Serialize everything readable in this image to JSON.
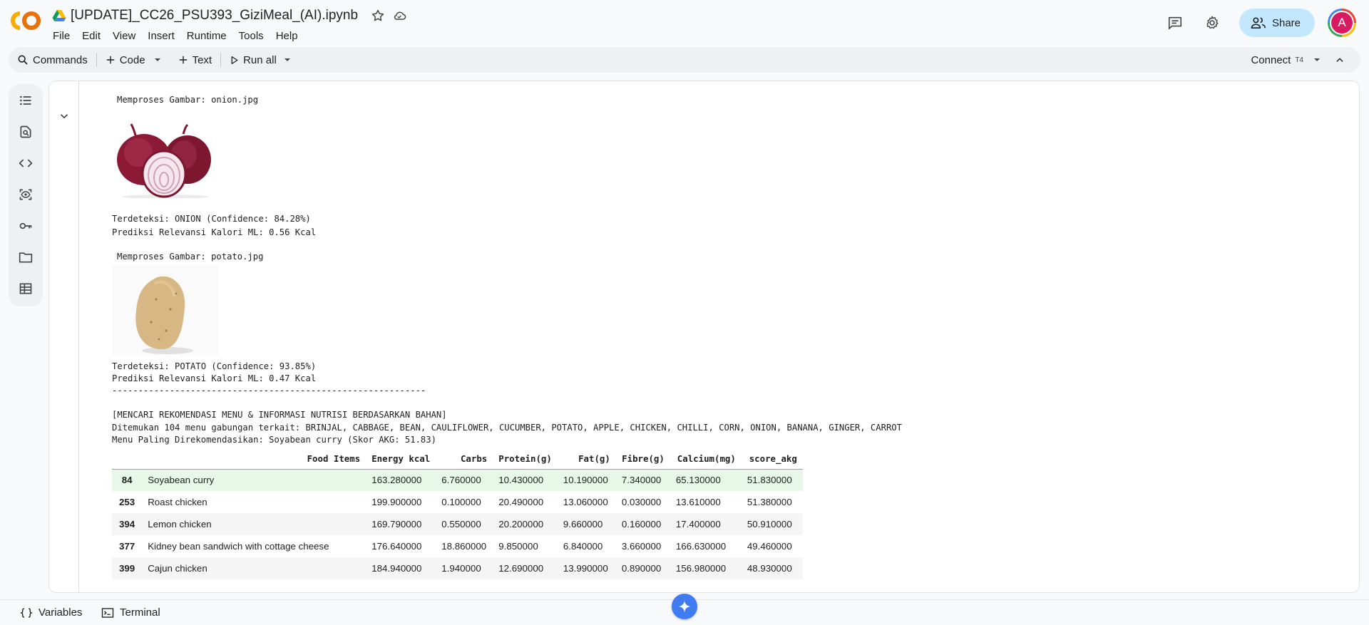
{
  "app": {
    "title": "[UPDATE]_CC26_PSU393_GiziMeal_(AI).ipynb",
    "menu": [
      "File",
      "Edit",
      "View",
      "Insert",
      "Runtime",
      "Tools",
      "Help"
    ],
    "share_label": "Share",
    "avatar_letter": "A"
  },
  "toolbar": {
    "commands": "Commands",
    "code": "Code",
    "text": "Text",
    "run_all": "Run all",
    "connect": "Connect",
    "runtime_badge": "T4"
  },
  "sidebar_icons": [
    "table-of-contents-icon",
    "find-replace-icon",
    "code-snippets-icon",
    "variable-inspector-icon",
    "secrets-key-icon",
    "files-folder-icon",
    "data-table-icon"
  ],
  "output": {
    "onion_header": "Memproses Gambar: onion.jpg",
    "onion_detect": "Terdeteksi: ONION (Confidence: 84.28%)",
    "onion_pred": "Prediksi Relevansi Kalori ML: 0.56 Kcal",
    "potato_header": "Memproses Gambar: potato.jpg",
    "potato_detect": "Terdeteksi: POTATO (Confidence: 93.85%)",
    "potato_pred": "Prediksi Relevansi Kalori ML: 0.47 Kcal",
    "separator": "------------------------------------------------------------",
    "rec_header": "[MENCARI REKOMENDASI MENU & INFORMASI NUTRISI BERDASARKAN BAHAN]",
    "found": "Ditemukan 104 menu gabungan terkait: BRINJAL, CABBAGE, BEAN, CAULIFLOWER, CUCUMBER, POTATO, APPLE, CHICKEN, CHILLI, CORN, ONION, BANANA, GINGER, CARROT",
    "best": "Menu Paling Direkomendasikan: Soyabean curry (Skor AKG: 51.83)"
  },
  "table": {
    "columns": [
      "",
      "Food Items",
      "Energy kcal",
      "Carbs",
      "Protein(g)",
      "Fat(g)",
      "Fibre(g)",
      "Calcium(mg)",
      "score_akg"
    ],
    "rows": [
      [
        "84",
        "Soyabean curry",
        "163.280000",
        "6.760000",
        "10.430000",
        "10.190000",
        "7.340000",
        "65.130000",
        "51.830000"
      ],
      [
        "253",
        "Roast chicken",
        "199.900000",
        "0.100000",
        "20.490000",
        "13.060000",
        "0.030000",
        "13.610000",
        "51.380000"
      ],
      [
        "394",
        "Lemon chicken",
        "169.790000",
        "0.550000",
        "20.200000",
        "9.660000",
        "0.160000",
        "17.400000",
        "50.910000"
      ],
      [
        "377",
        "Kidney bean sandwich with cottage cheese",
        "176.640000",
        "18.860000",
        "9.850000",
        "6.840000",
        "3.660000",
        "166.630000",
        "49.460000"
      ],
      [
        "399",
        "Cajun chicken",
        "184.940000",
        "1.940000",
        "12.690000",
        "13.990000",
        "0.890000",
        "156.980000",
        "48.930000"
      ]
    ]
  },
  "bottom": {
    "variables": "Variables",
    "terminal": "Terminal"
  },
  "colors": {
    "accent": "#c2e7ff",
    "highlight_row": "#e8f8e8",
    "gemini": "#3f7cf4"
  }
}
